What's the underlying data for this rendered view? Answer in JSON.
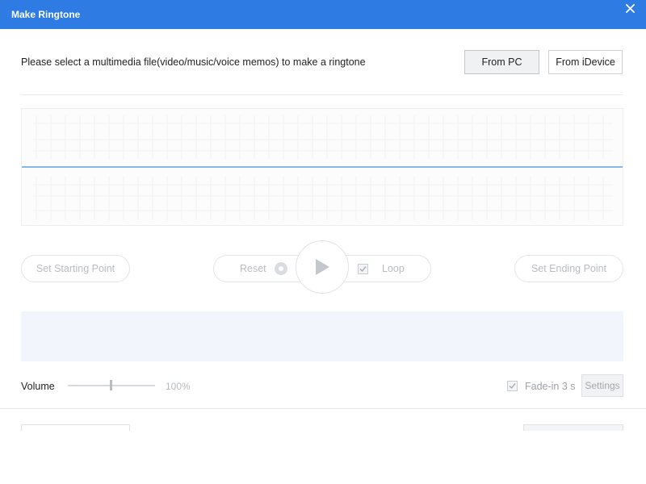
{
  "window": {
    "title": "Make Ringtone"
  },
  "source": {
    "prompt": "Please select a multimedia file(video/music/voice memos) to make a ringtone",
    "from_pc": "From PC",
    "from_idevice": "From iDevice"
  },
  "controls": {
    "set_start": "Set Starting Point",
    "reset": "Reset",
    "loop": "Loop",
    "set_end": "Set Ending Point"
  },
  "volume": {
    "label": "Volume",
    "value_text": "100%"
  },
  "fade": {
    "label": "Fade-in 3 s",
    "checked": true
  },
  "settings": {
    "label": "Settings"
  },
  "colors": {
    "titlebar": "#2d7be3",
    "waveform_line": "#3a8fe6",
    "panel": "#f2f6fc"
  }
}
